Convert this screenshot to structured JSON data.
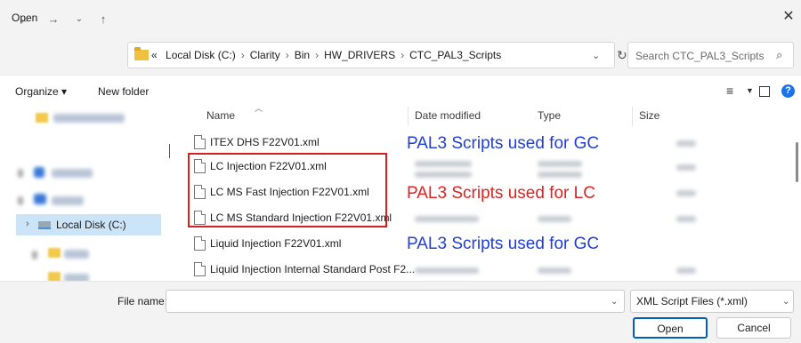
{
  "window": {
    "title": "Open"
  },
  "address": {
    "crumbs": [
      "«",
      "Local Disk (C:)",
      "Clarity",
      "Bin",
      "HW_DRIVERS",
      "CTC_PAL3_Scripts"
    ],
    "search_placeholder": "Search CTC_PAL3_Scripts"
  },
  "toolbar": {
    "organize": "Organize ▾",
    "new_folder": "New folder"
  },
  "nav": {
    "selected_drive": "Local Disk (C:)"
  },
  "columns": {
    "name": "Name",
    "date": "Date modified",
    "type": "Type",
    "size": "Size"
  },
  "files": [
    {
      "name": "ITEX DHS F22V01.xml"
    },
    {
      "name": "LC Injection F22V01.xml"
    },
    {
      "name": "LC MS Fast Injection F22V01.xml"
    },
    {
      "name": "LC MS Standard Injection F22V01.xml"
    },
    {
      "name": "Liquid Injection F22V01.xml"
    },
    {
      "name": "Liquid Injection Internal Standard Post F2..."
    }
  ],
  "annotations": {
    "gc_top": "PAL3 Scripts used for GC",
    "lc": "PAL3 Scripts used for LC",
    "gc_bottom": "PAL3 Scripts used for GC",
    "gc_color": "#1f3fd8",
    "lc_color": "#e02222"
  },
  "bottom": {
    "file_name_label": "File name:",
    "file_name_value": "",
    "filter": "XML Script Files (*.xml)",
    "open": "Open",
    "cancel": "Cancel"
  }
}
